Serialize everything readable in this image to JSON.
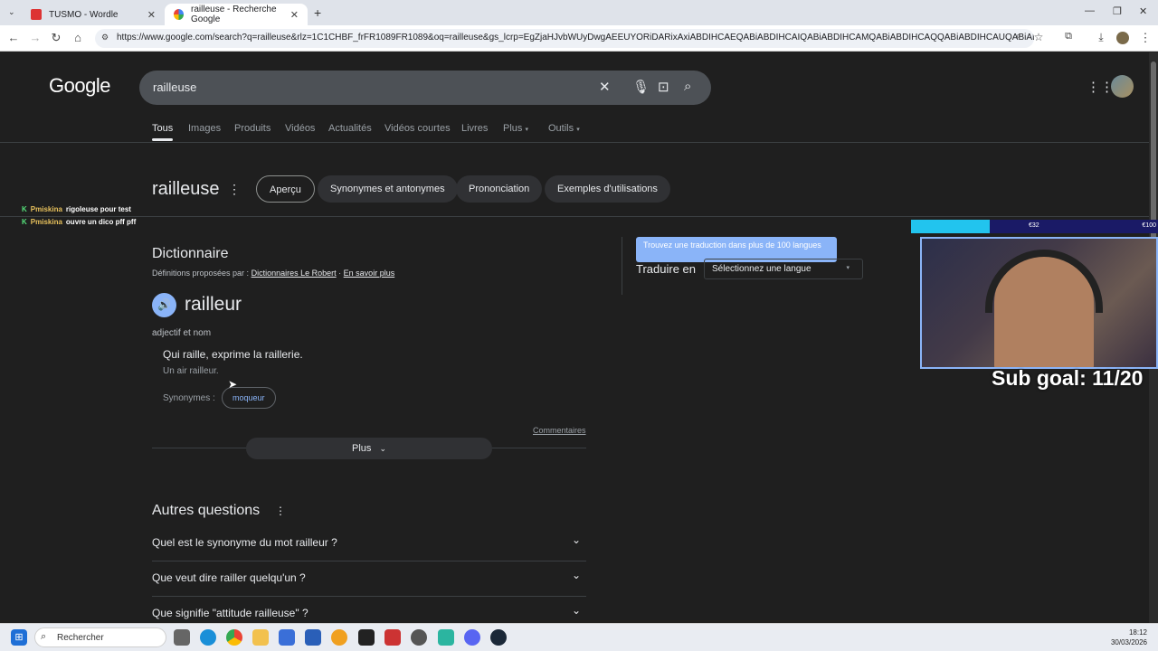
{
  "browser": {
    "tabs": [
      {
        "title": "TUSMO - Wordle"
      },
      {
        "title": "railleuse - Recherche Google"
      }
    ],
    "url": "https://www.google.com/search?q=railleuse&rlz=1C1CHBF_frFR1089FR1089&oq=railleuse&gs_lcrp=EgZjaHJvbWUyDwgAEEUYORiDARixAxiABDIHCAEQABiABDIHCAIQABiABDIHCAMQABiABDIHCAQQABiABDIHCAUQABiABDIHCAYQABiAB..."
  },
  "google": {
    "logo": "Google",
    "query": "railleuse",
    "nav_tabs": [
      "Tous",
      "Images",
      "Produits",
      "Vidéos",
      "Actualités",
      "Vidéos courtes",
      "Livres",
      "Plus",
      "Outils"
    ],
    "headword": "railleuse",
    "pills": [
      "Aperçu",
      "Synonymes et antonymes",
      "Prononciation",
      "Exemples d'utilisations"
    ]
  },
  "chat": [
    {
      "user": "Pmiskina",
      "message": "rigoleuse pour test"
    },
    {
      "user": "Pmiskina",
      "message": "ouvre un dico pff pff"
    }
  ],
  "dictionary": {
    "title": "Dictionnaire",
    "source_prefix": "Définitions proposées par :",
    "source_link": "Dictionnaires Le Robert",
    "source_sep": "·",
    "learn_more": "En savoir plus",
    "word": "railleur",
    "category": "adjectif et nom",
    "definition": "Qui raille, exprime la raillerie.",
    "example": "Un air railleur.",
    "synonyms_label": "Synonymes :",
    "synonym": "moqueur",
    "feedback": "Commentaires",
    "more_label": "Plus"
  },
  "translate": {
    "tooltip": "Trouvez une traduction dans plus de 100 langues",
    "label": "Traduire en",
    "select_placeholder": "Sélectionnez une langue"
  },
  "paa": {
    "title": "Autres questions",
    "questions": [
      "Quel est le synonyme du mot railleur ?",
      "Que veut dire railler quelqu'un ?",
      "Que signifie \"attitude railleuse\" ?"
    ]
  },
  "overlay": {
    "goal_left": "€32",
    "goal_right": "€100",
    "goal_progress": 0.32,
    "sub_goal": "Sub goal: 11/20"
  },
  "taskbar": {
    "search_placeholder": "Rechercher",
    "time": "18:12",
    "date": "30/03/2026"
  }
}
